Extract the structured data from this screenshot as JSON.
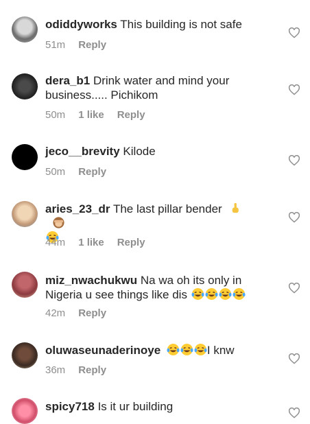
{
  "comments": [
    {
      "username": "odiddyworks",
      "text": "This building is not safe",
      "time": "51m",
      "likes": "",
      "reply": "Reply"
    },
    {
      "username": "dera_b1",
      "text": "Drink water and mind your business..... Pichikom",
      "time": "50m",
      "likes": "1 like",
      "reply": "Reply"
    },
    {
      "username": "jeco__brevity",
      "text": "Kilode",
      "time": "50m",
      "likes": "",
      "reply": "Reply"
    },
    {
      "username": "aries_23_dr",
      "text": "The last pillar bender",
      "time": "44m",
      "likes": "1 like",
      "reply": "Reply"
    },
    {
      "username": "miz_nwachukwu",
      "text": "Na wa oh its only in Nigeria u see things like dis",
      "time": "42m",
      "likes": "",
      "reply": "Reply"
    },
    {
      "username": "oluwaseunaderinoye",
      "text": "I knw",
      "time": "36m",
      "likes": "",
      "reply": "Reply"
    },
    {
      "username": "spicy718",
      "text": "Is it ur building",
      "time": "",
      "likes": "",
      "reply": ""
    }
  ],
  "colors": {
    "primary_text": "#262626",
    "secondary_text": "#8e8e8e",
    "heart_outline": "#8e8e8e"
  },
  "icons": {
    "like": "heart-outline-icon",
    "laugh": "laughing-crying-emoji",
    "finger": "index-up-emoji",
    "monkey": "see-no-evil-monkey-emoji"
  }
}
